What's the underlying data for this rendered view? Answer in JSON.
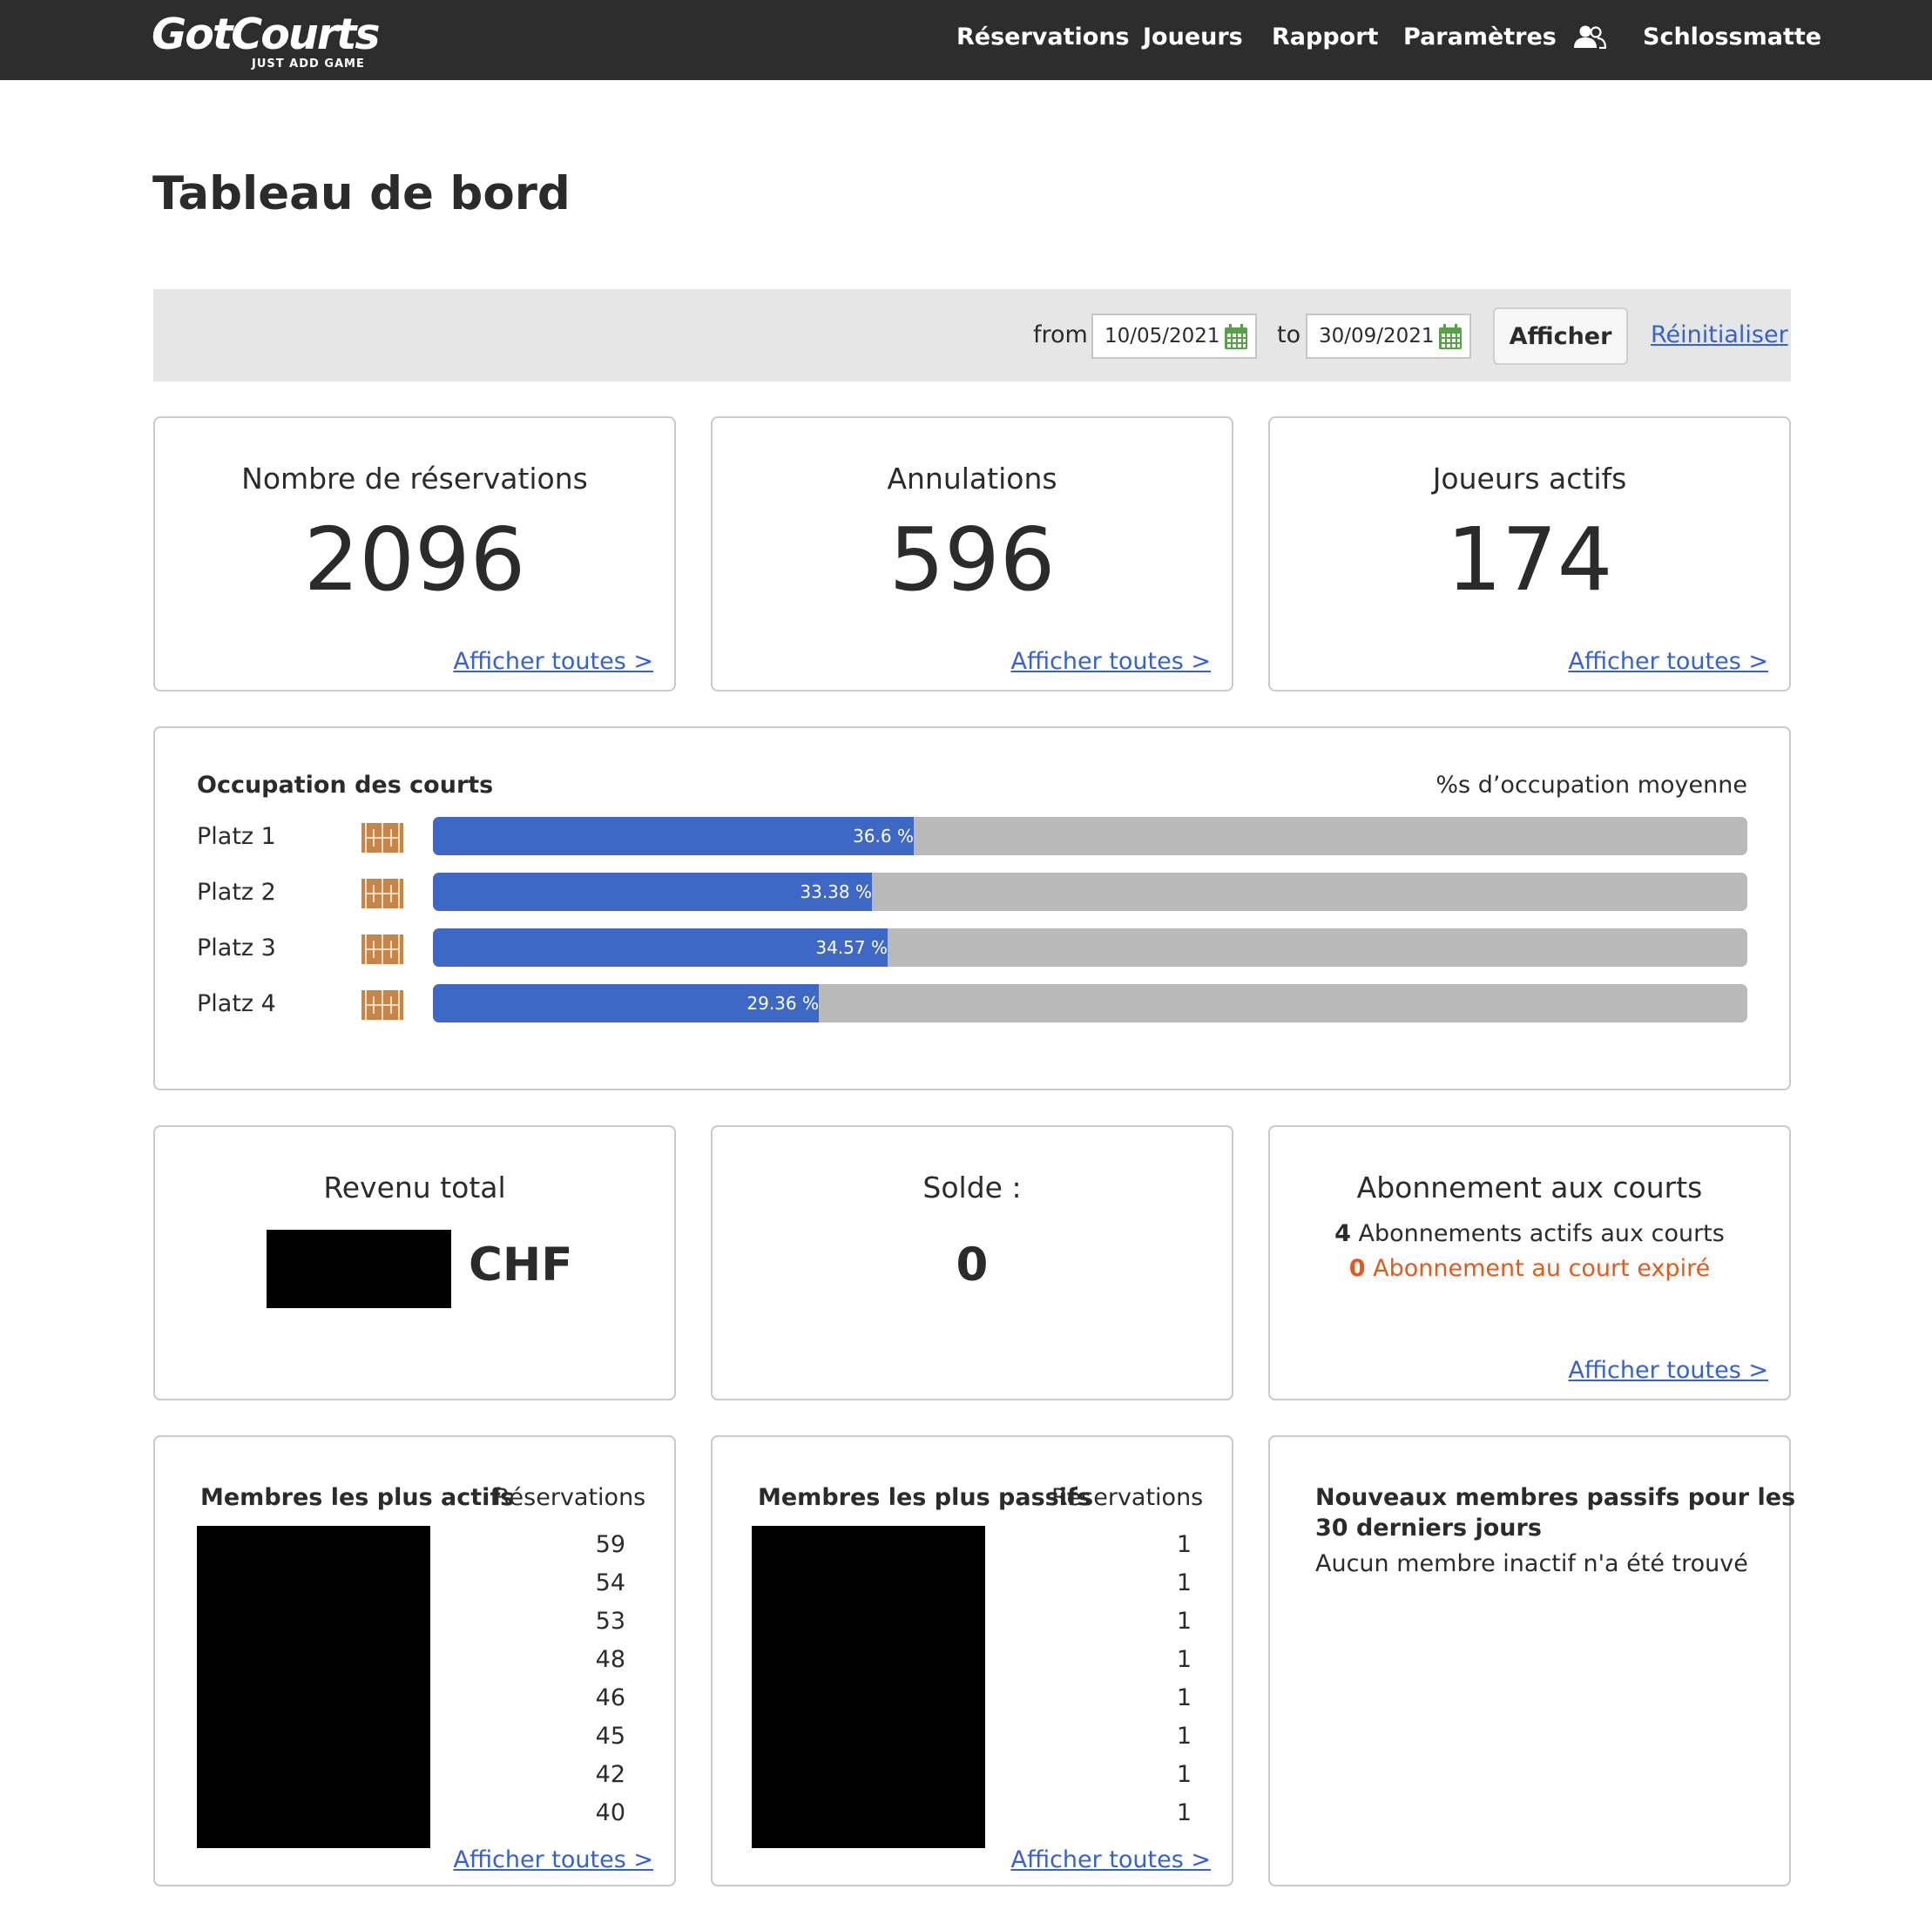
{
  "header": {
    "logo_text": "GotCourts",
    "logo_tagline": "JUST ADD GAME",
    "nav": {
      "reservations": "Réservations",
      "joueurs": "Joueurs",
      "rapport": "Rapport",
      "parametres": "Paramètres",
      "club": "Schlossmatte"
    }
  },
  "page": {
    "title": "Tableau de bord"
  },
  "filter": {
    "from_label": "from",
    "from_value": "10/05/2021",
    "to_label": "to",
    "to_value": "30/09/2021",
    "submit_label": "Afficher",
    "reset_label": "Réinitialiser"
  },
  "stats": {
    "reservations": {
      "title": "Nombre de réservations",
      "value": "2096",
      "link": "Afficher toutes >"
    },
    "annulations": {
      "title": "Annulations",
      "value": "596",
      "link": "Afficher toutes >"
    },
    "joueurs": {
      "title": "Joueurs actifs",
      "value": "174",
      "link": "Afficher toutes >"
    }
  },
  "occupation": {
    "title": "Occupation des courts",
    "subtitle": "%s d’occupation moyenne",
    "courts": [
      {
        "name": "Platz 1",
        "percent": 36.6,
        "label": "36.6 %"
      },
      {
        "name": "Platz 2",
        "percent": 33.38,
        "label": "33.38 %"
      },
      {
        "name": "Platz 3",
        "percent": 34.57,
        "label": "34.57 %"
      },
      {
        "name": "Platz 4",
        "percent": 29.36,
        "label": "29.36 %"
      }
    ]
  },
  "revenue": {
    "title": "Revenu total",
    "currency": "CHF"
  },
  "balance": {
    "title": "Solde :",
    "value": "0"
  },
  "subscriptions": {
    "title": "Abonnement aux courts",
    "active_count": "4",
    "active_text": "Abonnements actifs aux courts",
    "expired_count": "0",
    "expired_text": "Abonnement au court expiré",
    "link": "Afficher toutes >"
  },
  "most_active": {
    "title": "Membres les plus actifs",
    "column": "Réservations",
    "values": [
      "59",
      "54",
      "53",
      "48",
      "46",
      "45",
      "42",
      "40"
    ],
    "link": "Afficher toutes >"
  },
  "most_passive": {
    "title": "Membres les plus passifs",
    "column": "Réservations",
    "values": [
      "1",
      "1",
      "1",
      "1",
      "1",
      "1",
      "1",
      "1"
    ],
    "link": "Afficher toutes >"
  },
  "new_passive": {
    "title_line1": "Nouveaux membres passifs pour les",
    "title_line2": "30 derniers jours",
    "message": "Aucun membre inactif n'a été trouvé"
  },
  "colors": {
    "topbar": "#2d2d2d",
    "bar_fill": "#3e68c5",
    "bar_track": "#b9b9b9",
    "link": "#3563c9",
    "expired": "#e25a1c",
    "court_icon": "#c98545",
    "calendar_icon": "#5aa04a"
  }
}
